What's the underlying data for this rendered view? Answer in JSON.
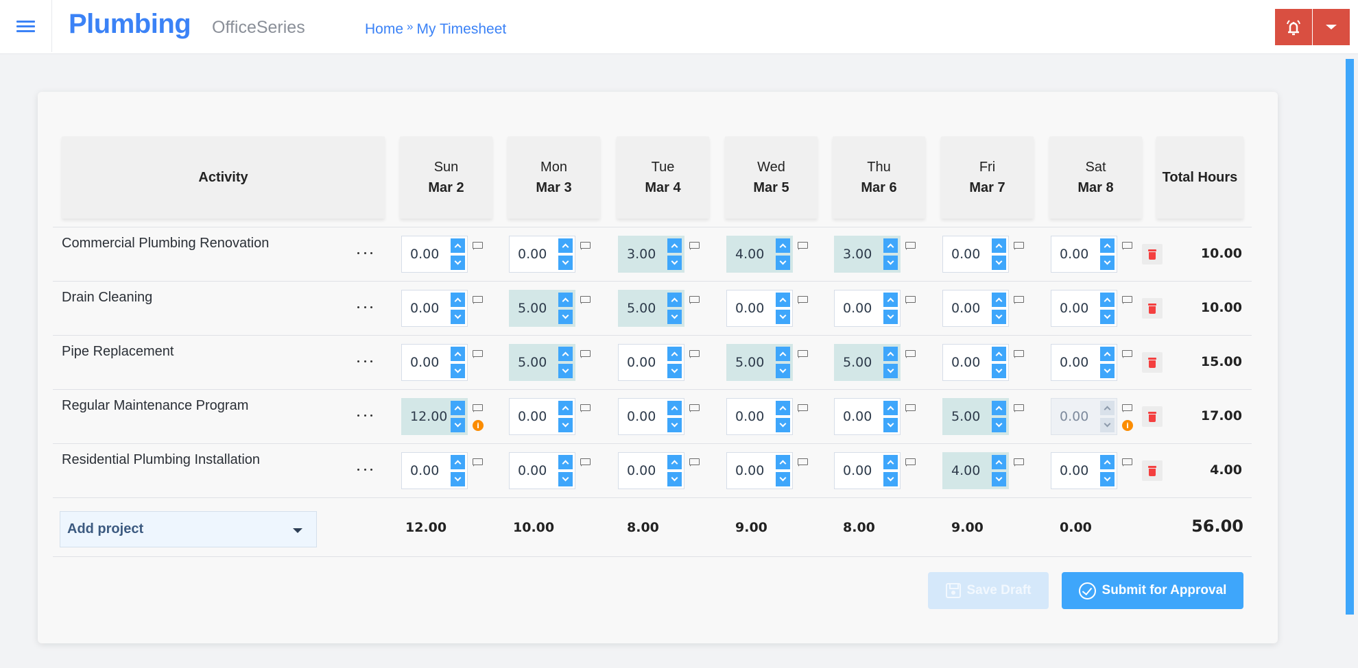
{
  "app": {
    "brand": "Plumbing",
    "product": "OfficeSeries",
    "breadcrumb": [
      {
        "label": "Home"
      },
      {
        "label": "My Timesheet"
      }
    ],
    "breadcrumb_separator": "»",
    "icons": {
      "menu": "hamburger-icon",
      "notifications": "bell-icon",
      "dropdown": "caret-down-icon"
    }
  },
  "colors": {
    "accent": "#3b82f6",
    "spinner": "#3ea6fb",
    "danger": "#d94f41",
    "filled_cell": "#d3e7e7",
    "warning": "#fb8c00"
  },
  "timesheet": {
    "headers": {
      "activity": "Activity",
      "total": "Total Hours",
      "days": [
        {
          "day": "Sun",
          "date": "Mar 2"
        },
        {
          "day": "Mon",
          "date": "Mar 3"
        },
        {
          "day": "Tue",
          "date": "Mar 4"
        },
        {
          "day": "Wed",
          "date": "Mar 5"
        },
        {
          "day": "Thu",
          "date": "Mar 6"
        },
        {
          "day": "Fri",
          "date": "Mar 7"
        },
        {
          "day": "Sat",
          "date": "Mar 8"
        }
      ]
    },
    "rows": [
      {
        "activity": "Commercial Plumbing Renovation",
        "hours": [
          "0.00",
          "0.00",
          "3.00",
          "4.00",
          "3.00",
          "0.00",
          "0.00"
        ],
        "total": "10.00",
        "warnings": [],
        "disabled": []
      },
      {
        "activity": "Drain Cleaning",
        "hours": [
          "0.00",
          "5.00",
          "5.00",
          "0.00",
          "0.00",
          "0.00",
          "0.00"
        ],
        "total": "10.00",
        "warnings": [],
        "disabled": []
      },
      {
        "activity": "Pipe Replacement",
        "hours": [
          "0.00",
          "5.00",
          "0.00",
          "5.00",
          "5.00",
          "0.00",
          "0.00"
        ],
        "total": "15.00",
        "warnings": [],
        "disabled": []
      },
      {
        "activity": "Regular Maintenance Program",
        "hours": [
          "12.00",
          "0.00",
          "0.00",
          "0.00",
          "0.00",
          "5.00",
          "0.00"
        ],
        "total": "17.00",
        "warnings": [
          0,
          6
        ],
        "disabled": [
          6
        ]
      },
      {
        "activity": "Residential Plumbing Installation",
        "hours": [
          "0.00",
          "0.00",
          "0.00",
          "0.00",
          "0.00",
          "4.00",
          "0.00"
        ],
        "total": "4.00",
        "warnings": [],
        "disabled": []
      }
    ],
    "day_totals": [
      "12.00",
      "10.00",
      "8.00",
      "9.00",
      "8.00",
      "9.00",
      "0.00"
    ],
    "grand_total": "56.00",
    "add_project_label": "Add project",
    "info_glyph": "i"
  },
  "actions": {
    "save_draft": "Save Draft",
    "submit": "Submit for Approval"
  }
}
